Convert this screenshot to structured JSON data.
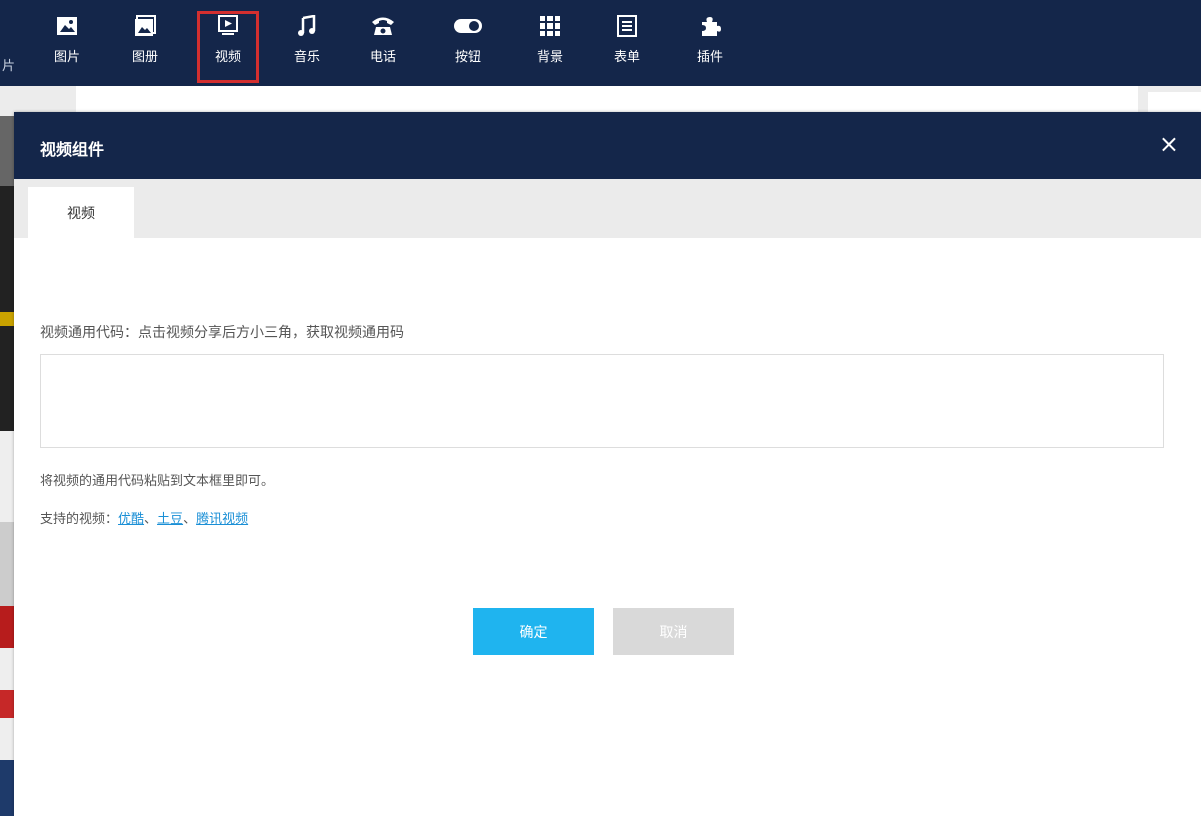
{
  "toolbar": {
    "edge_text": "片",
    "items": [
      {
        "label": "图片",
        "icon": "image-icon"
      },
      {
        "label": "图册",
        "icon": "album-icon"
      },
      {
        "label": "视频",
        "icon": "video-icon"
      },
      {
        "label": "音乐",
        "icon": "music-icon"
      },
      {
        "label": "电话",
        "icon": "phone-icon"
      },
      {
        "label": "按钮",
        "icon": "toggle-icon"
      },
      {
        "label": "背景",
        "icon": "grid-icon"
      },
      {
        "label": "表单",
        "icon": "form-icon"
      },
      {
        "label": "插件",
        "icon": "puzzle-icon"
      }
    ],
    "active": "视频"
  },
  "dialog": {
    "title": "视频组件",
    "close": "×",
    "tab": "视频",
    "instruction": "视频通用代码：点击视频分享后方小三角，获取视频通用码",
    "code_value": "",
    "hint": "将视频的通用代码粘贴到文本框里即可。",
    "support_prefix": "支持的视频：",
    "support_links": [
      "优酷",
      "土豆",
      "腾讯视频"
    ],
    "separator": "、",
    "ok": "确定",
    "cancel": "取消"
  },
  "colors": {
    "header": "#14264a",
    "primary_button": "#1fb4ef",
    "disabled_button": "#d9d9d9",
    "link": "#1a8fd6",
    "active_outline": "#d32f2f"
  }
}
